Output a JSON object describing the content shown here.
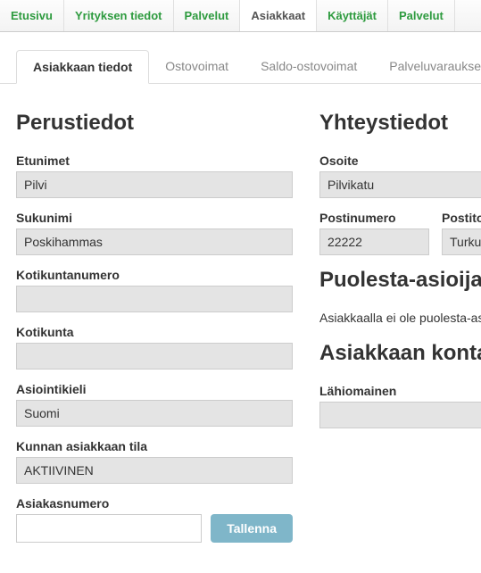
{
  "topnav": {
    "items": [
      {
        "label": "Etusivu"
      },
      {
        "label": "Yrityksen tiedot"
      },
      {
        "label": "Palvelut"
      },
      {
        "label": "Asiakkaat"
      },
      {
        "label": "Käyttäjät"
      },
      {
        "label": "Palvelut"
      }
    ],
    "activeIndex": 3
  },
  "subtabs": {
    "items": [
      {
        "label": "Asiakkaan tiedot"
      },
      {
        "label": "Ostovoimat"
      },
      {
        "label": "Saldo-ostovoimat"
      },
      {
        "label": "Palveluvaraukset"
      }
    ],
    "activeIndex": 0
  },
  "sections": {
    "perustiedot": {
      "heading": "Perustiedot",
      "etunimet": {
        "label": "Etunimet",
        "value": "Pilvi"
      },
      "sukunimi": {
        "label": "Sukunimi",
        "value": "Poskihammas"
      },
      "kotikuntanumero": {
        "label": "Kotikuntanumero",
        "value": ""
      },
      "kotikunta": {
        "label": "Kotikunta",
        "value": ""
      },
      "asiointikieli": {
        "label": "Asiointikieli",
        "value": "Suomi"
      },
      "kunnan_tila": {
        "label": "Kunnan asiakkaan tila",
        "value": "AKTIIVINEN"
      },
      "asiakasnumero": {
        "label": "Asiakasnumero",
        "value": ""
      },
      "tallenna": "Tallenna"
    },
    "yhteystiedot": {
      "heading": "Yhteystiedot",
      "osoite": {
        "label": "Osoite",
        "value": "Pilvikatu"
      },
      "postinumero": {
        "label": "Postinumero",
        "value": "22222"
      },
      "postitoimipaikka": {
        "label": "Postitoimipaikka",
        "value": "Turku"
      }
    },
    "puolesta": {
      "heading": "Puolesta-asioija",
      "note": "Asiakkaalla ei ole puolesta-asioijaa"
    },
    "kontaktit": {
      "heading": "Asiakkaan kontaktit",
      "lahiomainen": {
        "label": "Lähiomainen",
        "value": ""
      }
    }
  }
}
